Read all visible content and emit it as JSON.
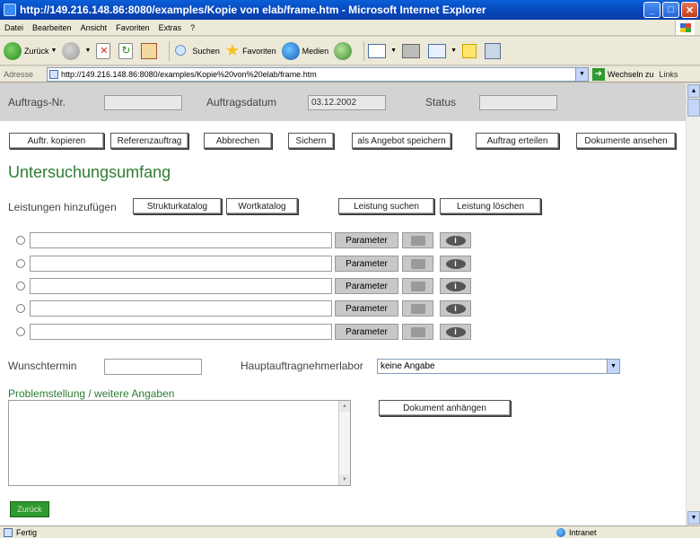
{
  "window": {
    "title": "http://149.216.148.86:8080/examples/Kopie von elab/frame.htm - Microsoft Internet Explorer",
    "minimize": "_",
    "maximize": "□",
    "close": "✕"
  },
  "menu": [
    "Datei",
    "Bearbeiten",
    "Ansicht",
    "Favoriten",
    "Extras",
    "?"
  ],
  "toolbar": {
    "back": "Zurück",
    "search": "Suchen",
    "favorites": "Favoriten",
    "media": "Medien"
  },
  "address": {
    "label": "Adresse",
    "url": "http://149.216.148.86:8080/examples/Kopie%20von%20elab/frame.htm",
    "go": "Wechseln zu",
    "links": "Links"
  },
  "header": {
    "order_no_label": "Auftrags-Nr.",
    "order_no_value": "",
    "order_date_label": "Auftragsdatum",
    "order_date_value": "03.12.2002",
    "status_label": "Status",
    "status_value": ""
  },
  "actions": {
    "copy_order": "Auftr. kopieren",
    "reference_order": "Referenzauftrag",
    "cancel": "Abbrechen",
    "save": "Sichern",
    "save_as_offer": "als Angebot speichern",
    "place_order": "Auftrag erteilen",
    "view_documents": "Dokumente ansehen"
  },
  "section": {
    "title": "Untersuchungsumfang",
    "add_services_label": "Leistungen hinzufügen",
    "structure_catalog": "Strukturkatalog",
    "word_catalog": "Wortkatalog",
    "search_service": "Leistung suchen",
    "delete_service": "Leistung löschen"
  },
  "services": [
    {
      "value": "",
      "param_label": "Parameter"
    },
    {
      "value": "",
      "param_label": "Parameter"
    },
    {
      "value": "",
      "param_label": "Parameter"
    },
    {
      "value": "",
      "param_label": "Parameter"
    },
    {
      "value": "",
      "param_label": "Parameter"
    }
  ],
  "details": {
    "desired_date_label": "Wunschtermin",
    "desired_date_value": "",
    "main_contractor_label": "Hauptauftragnehmerlabor",
    "main_contractor_value": "keine Angabe",
    "problem_label": "Problemstellung / weitere Angaben",
    "problem_value": "",
    "attach_document": "Dokument anhängen"
  },
  "back_button": "Zurück",
  "status": {
    "text": "Fertig",
    "zone": "Intranet"
  }
}
